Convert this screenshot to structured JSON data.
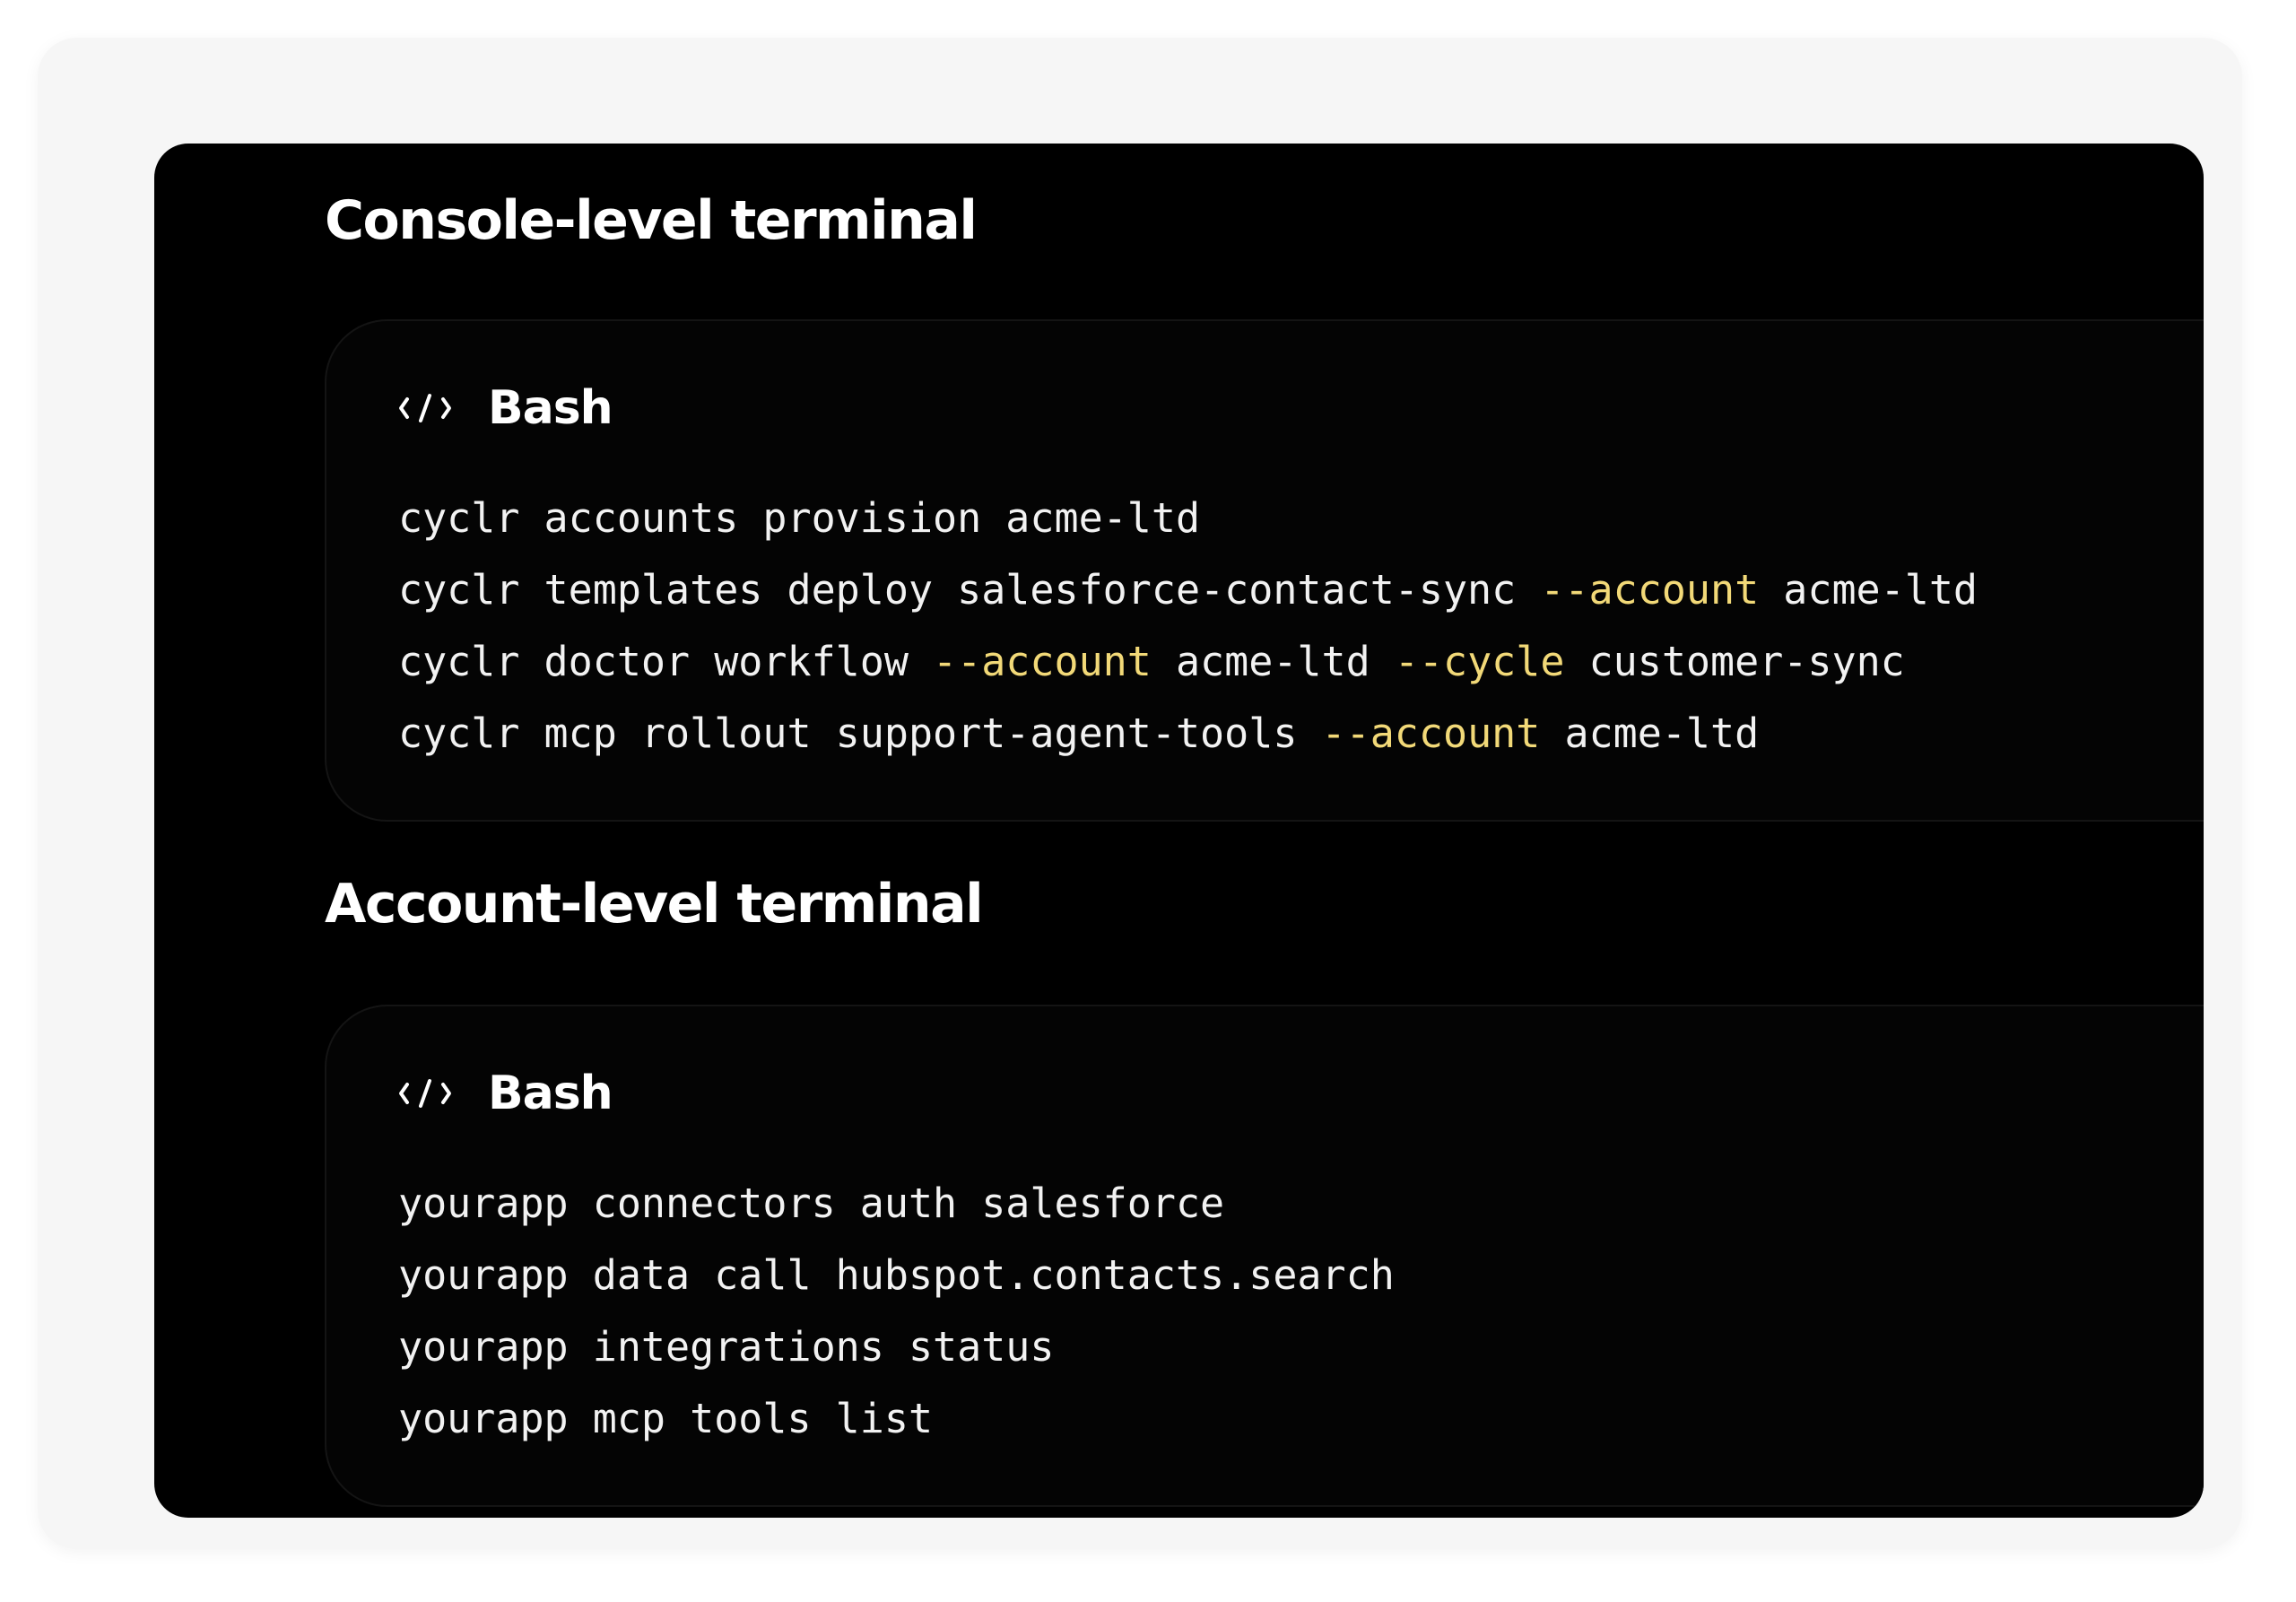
{
  "sections": [
    {
      "title": "Console-level terminal",
      "code_block": {
        "language": "Bash",
        "icon": "code-brackets-icon",
        "lines": [
          [
            {
              "text": "cyclr accounts provision acme-ltd",
              "kind": "plain"
            }
          ],
          [
            {
              "text": "cyclr templates deploy salesforce-contact-sync ",
              "kind": "plain"
            },
            {
              "text": "--account",
              "kind": "flag"
            },
            {
              "text": " acme-ltd",
              "kind": "plain"
            }
          ],
          [
            {
              "text": "cyclr doctor workflow ",
              "kind": "plain"
            },
            {
              "text": "--account",
              "kind": "flag"
            },
            {
              "text": " acme-ltd ",
              "kind": "plain"
            },
            {
              "text": "--cycle",
              "kind": "flag"
            },
            {
              "text": " customer-sync",
              "kind": "plain"
            }
          ],
          [
            {
              "text": "cyclr mcp rollout support-agent-tools ",
              "kind": "plain"
            },
            {
              "text": "--account",
              "kind": "flag"
            },
            {
              "text": " acme-ltd",
              "kind": "plain"
            }
          ]
        ]
      }
    },
    {
      "title": "Account-level terminal",
      "code_block": {
        "language": "Bash",
        "icon": "code-brackets-icon",
        "lines": [
          [
            {
              "text": "yourapp connectors auth salesforce",
              "kind": "plain"
            }
          ],
          [
            {
              "text": "yourapp data call hubspot.contacts.search",
              "kind": "plain"
            }
          ],
          [
            {
              "text": "yourapp integrations status",
              "kind": "plain"
            }
          ],
          [
            {
              "text": "yourapp mcp tools list",
              "kind": "plain"
            }
          ]
        ]
      }
    }
  ],
  "colors": {
    "panel_background": "#000000",
    "code_text": "#f2f2f2",
    "flag_token": "#f2d978",
    "heading_text": "#ffffff"
  }
}
